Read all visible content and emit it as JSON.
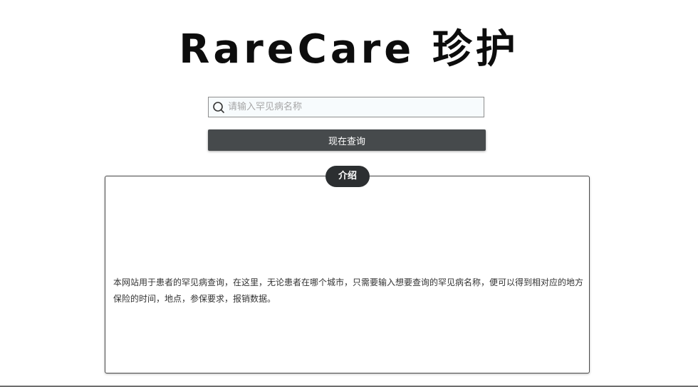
{
  "header": {
    "logo_text": "RareCare 珍护"
  },
  "search": {
    "placeholder": "请输入罕见病名称",
    "value": "",
    "icon": "search-icon",
    "button_label": "现在查询"
  },
  "intro": {
    "badge_label": "介绍",
    "text": "本网站用于患者的罕见病查询，在这里，无论患者在哪个城市，只需要输入想要查询的罕见病名称，便可以得到相对应的地方保险的时间，地点，参保要求，报销数据。"
  },
  "colors": {
    "button_bg": "#464a4c",
    "badge_bg": "#2c2f31",
    "search_bg": "#f7fbfd"
  }
}
